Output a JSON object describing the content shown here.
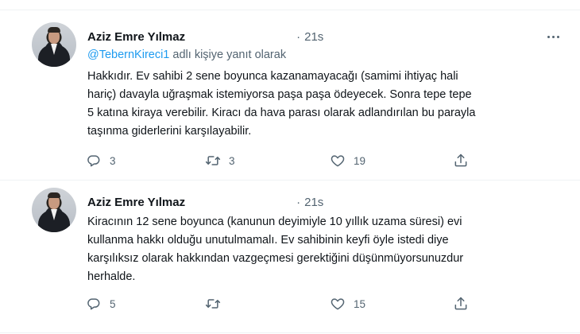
{
  "tweets": [
    {
      "author": "Aziz Emre Yılmaz",
      "separator": "·",
      "time": "21s",
      "reply_handle": "@TebernKireci1",
      "reply_suffix": " adlı kişiye yanıt olarak",
      "lines": [
        "Hakkıdır. Ev sahibi 2 sene boyunca kazanamayacağı (samimi ihtiyaç hali",
        "hariç) davayla uğraşmak istemiyorsa paşa paşa ödeyecek. Sonra tepe tepe",
        "5 katına kiraya verebilir. Kiracı da hava parası olarak adlandırılan bu parayla",
        "taşınma giderlerini karşılayabilir."
      ],
      "actions": {
        "reply_count": "3",
        "retweet_count": "3",
        "like_count": "19",
        "share_count": ""
      }
    },
    {
      "author": "Aziz Emre Yılmaz",
      "separator": "·",
      "time": "21s",
      "lines": [
        "Kiracının 12 sene boyunca (kanunun deyimiyle 10 yıllık uzama süresi) evi",
        "kullanma hakkı olduğu unutulmamalı. Ev sahibinin keyfi öyle istedi diye",
        "karşılıksız olarak hakkından vazgeçmesi gerektiğini düşünmüyorsunuzdur",
        "herhalde."
      ],
      "actions": {
        "reply_count": "5",
        "retweet_count": "",
        "like_count": "15",
        "share_count": ""
      }
    }
  ],
  "icons": {
    "reply": "reply-icon",
    "retweet": "retweet-icon",
    "like": "heart-icon",
    "share": "share-icon",
    "more": "more-options-icon"
  },
  "colors": {
    "text": "#0f1419",
    "muted": "#536471",
    "link": "#1d9bf0",
    "divider": "#eff3f4"
  }
}
